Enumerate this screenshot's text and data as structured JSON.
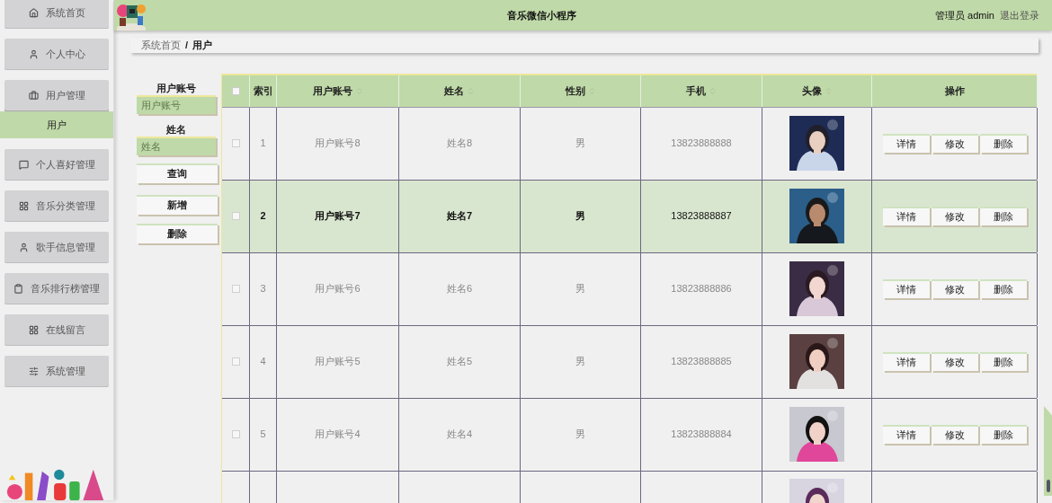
{
  "header": {
    "title": "音乐微信小程序",
    "user": "管理员 admin",
    "logout": "退出登录"
  },
  "sidebar": {
    "items": [
      {
        "label": "系统首页",
        "expanded": false
      },
      {
        "label": "个人中心",
        "expanded": false
      },
      {
        "label": "用户管理",
        "expanded": true,
        "children": [
          {
            "label": "用户",
            "selected": true
          }
        ]
      },
      {
        "label": "个人喜好管理",
        "expanded": false
      },
      {
        "label": "音乐分类管理",
        "expanded": false
      },
      {
        "label": "歌手信息管理",
        "expanded": false
      },
      {
        "label": "音乐排行榜管理",
        "expanded": false
      },
      {
        "label": "在线留言",
        "expanded": false
      },
      {
        "label": "系统管理",
        "expanded": false
      }
    ]
  },
  "breadcrumb": [
    "系统首页",
    "/",
    "用户"
  ],
  "search": {
    "fields": [
      {
        "label": "用户账号",
        "placeholder": "用户账号"
      },
      {
        "label": "姓名",
        "placeholder": "姓名"
      }
    ],
    "buttons": [
      "查询",
      "新增",
      "删除"
    ]
  },
  "table": {
    "columns": [
      "索引",
      "用户账号",
      "姓名",
      "性别",
      "手机",
      "头像",
      "操作"
    ],
    "sortable": [
      false,
      true,
      true,
      true,
      true,
      true,
      false
    ],
    "select_all_checked": false,
    "rows": [
      {
        "index": "1",
        "account": "用户账号8",
        "name": "姓名8",
        "gender": "男",
        "phone": "13823888888",
        "checked": false,
        "selected": false,
        "actions": [
          "详情",
          "修改",
          "删除"
        ]
      },
      {
        "index": "2",
        "account": "用户账号7",
        "name": "姓名7",
        "gender": "男",
        "phone": "13823888887",
        "checked": false,
        "selected": true,
        "actions": [
          "详情",
          "修改",
          "删除"
        ]
      },
      {
        "index": "3",
        "account": "用户账号6",
        "name": "姓名6",
        "gender": "男",
        "phone": "13823888886",
        "checked": false,
        "selected": false,
        "actions": [
          "详情",
          "修改",
          "删除"
        ]
      },
      {
        "index": "4",
        "account": "用户账号5",
        "name": "姓名5",
        "gender": "男",
        "phone": "13823888885",
        "checked": false,
        "selected": false,
        "actions": [
          "详情",
          "修改",
          "删除"
        ]
      },
      {
        "index": "5",
        "account": "用户账号4",
        "name": "姓名4",
        "gender": "男",
        "phone": "13823888884",
        "checked": false,
        "selected": false,
        "actions": [
          "详情",
          "修改",
          "删除"
        ]
      }
    ]
  }
}
